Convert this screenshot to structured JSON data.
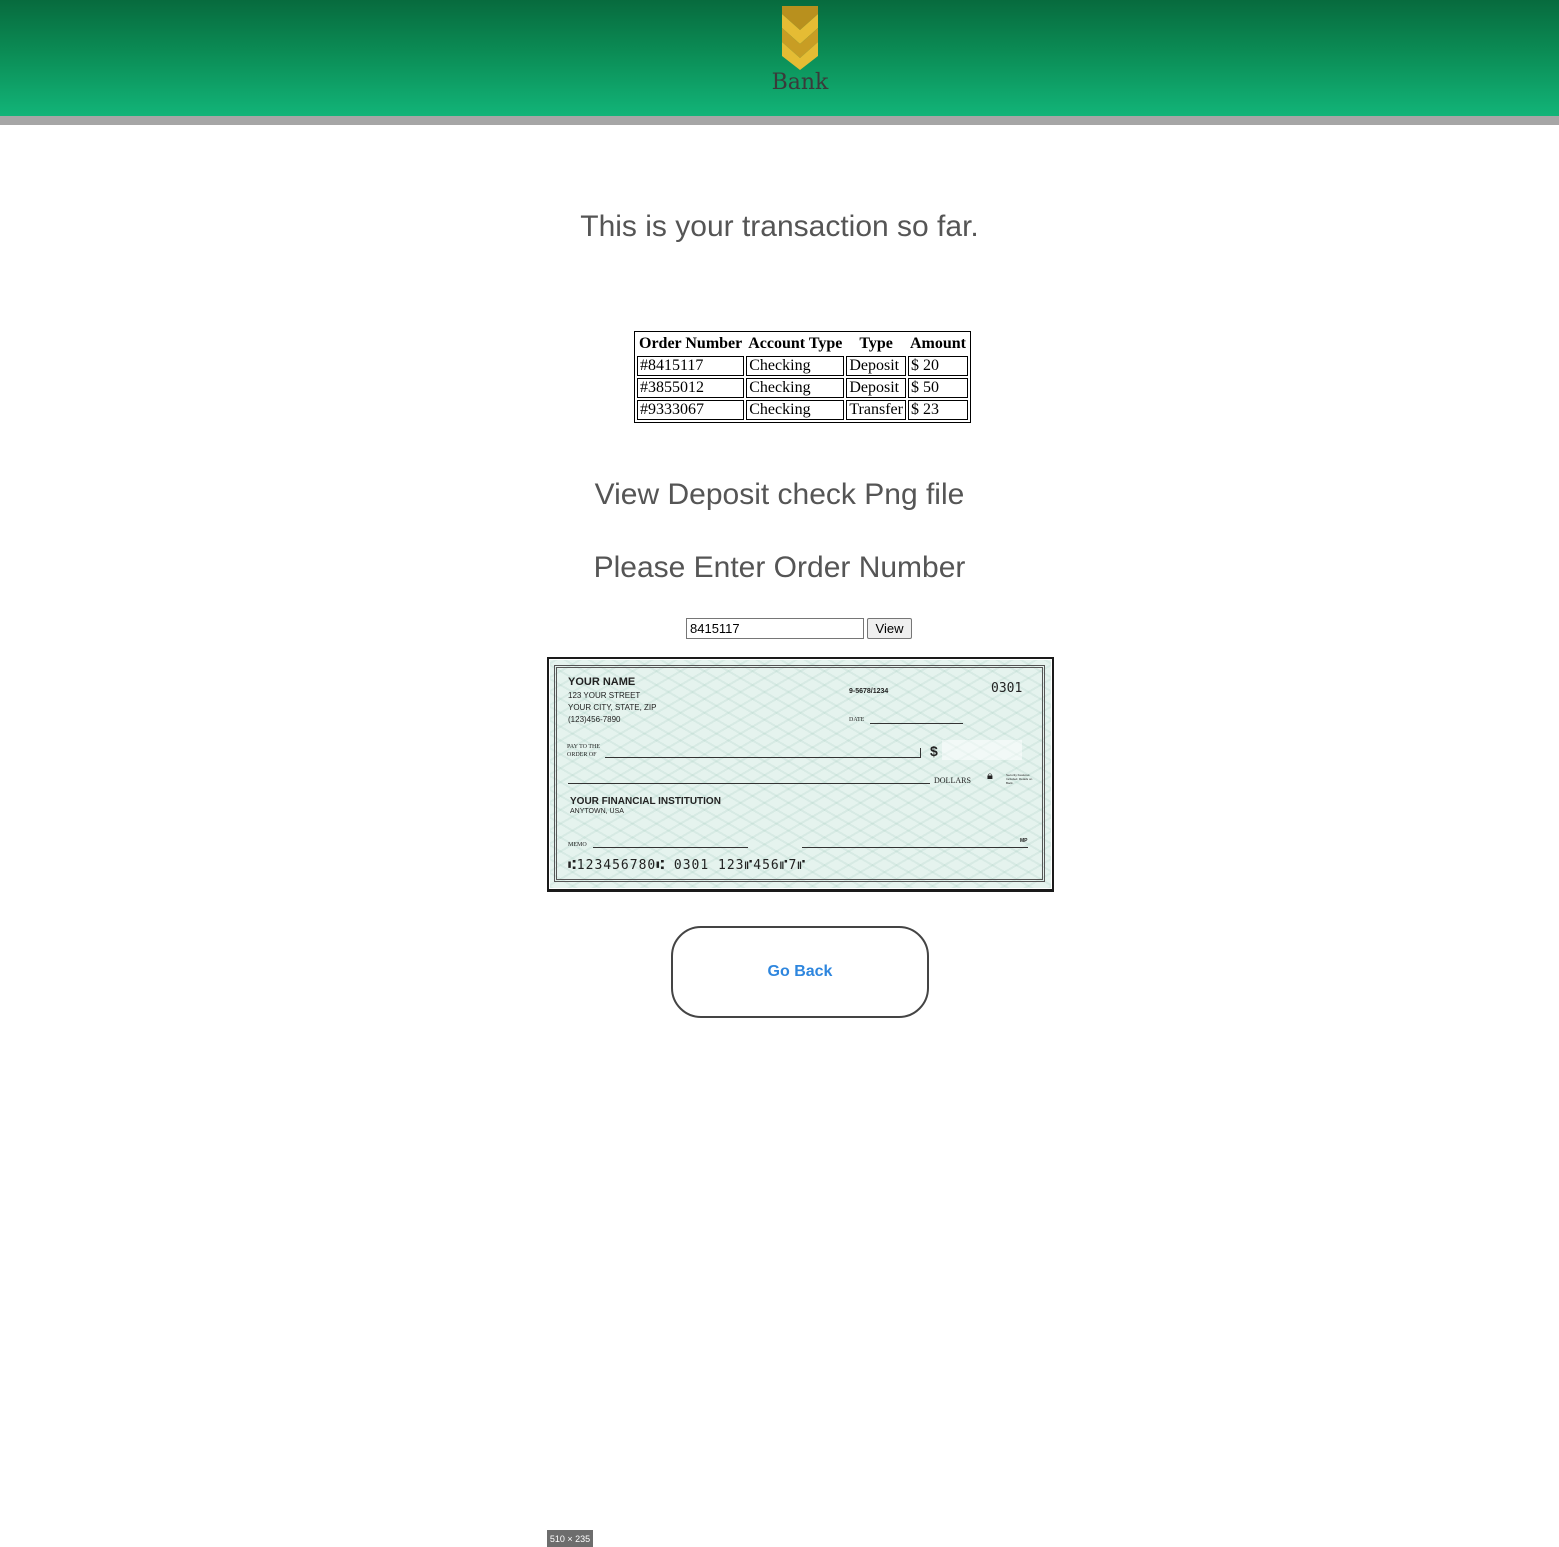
{
  "header": {
    "logo_text": "Bank",
    "brand_colors": [
      "#076b3e",
      "#12b478",
      "#d4aa2c",
      "#a6a6a6"
    ]
  },
  "page": {
    "title": "This is your transaction so far.",
    "view_heading": "View Deposit check Png file",
    "enter_heading": "Please Enter Order Number"
  },
  "transactions": {
    "columns": [
      "Order Number",
      "Account Type",
      "Type",
      "Amount"
    ],
    "rows": [
      [
        "#8415117",
        "Checking",
        "Deposit",
        "$ 20"
      ],
      [
        "#3855012",
        "Checking",
        "Deposit",
        "$ 50"
      ],
      [
        "#9333067",
        "Checking",
        "Transfer",
        "$ 23"
      ]
    ]
  },
  "order_form": {
    "input_value": "8415117",
    "view_label": "View"
  },
  "check": {
    "name": "YOUR NAME",
    "street": "123 YOUR STREET",
    "city": "YOUR CITY, STATE, ZIP",
    "phone": "(123)456-7890",
    "routing_fraction": "9-5678/1234",
    "check_number": "0301",
    "date_label": "DATE",
    "pay_label_1": "PAY TO THE",
    "pay_label_2": "ORDER OF",
    "dollar_sign": "$",
    "dollars_label": "DOLLARS",
    "security_note": "Security Features Included. Details on Back.",
    "institution": "YOUR FINANCIAL INSTITUTION",
    "institution_city": "ANYTOWN, USA",
    "memo_label": "MEMO",
    "mp_label": "MP",
    "micr_line": "⑆123456780⑆ 0301 123⑈456⑈7⑈",
    "size_badge": "510 × 235"
  },
  "actions": {
    "go_back_label": "Go Back"
  }
}
